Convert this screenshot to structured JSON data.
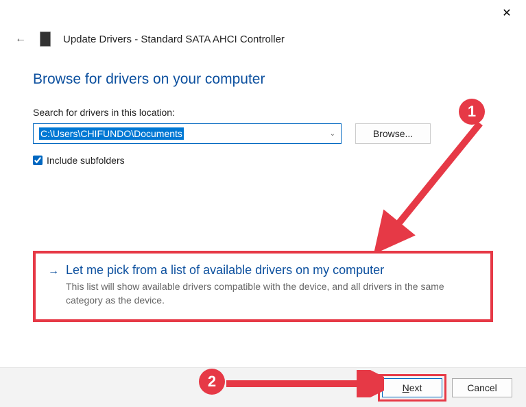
{
  "window": {
    "title": "Update Drivers - Standard SATA AHCI Controller"
  },
  "heading": "Browse for drivers on your computer",
  "search": {
    "label": "Search for drivers in this location:",
    "path": "C:\\Users\\CHIFUNDO\\Documents",
    "browse_label": "Browse..."
  },
  "include_subfolders": {
    "label": "Include subfolders",
    "checked": true
  },
  "option": {
    "title": "Let me pick from a list of available drivers on my computer",
    "description": "This list will show available drivers compatible with the device, and all drivers in the same category as the device."
  },
  "buttons": {
    "next": "Next",
    "cancel": "Cancel"
  },
  "annotations": {
    "badge1": "1",
    "badge2": "2"
  }
}
